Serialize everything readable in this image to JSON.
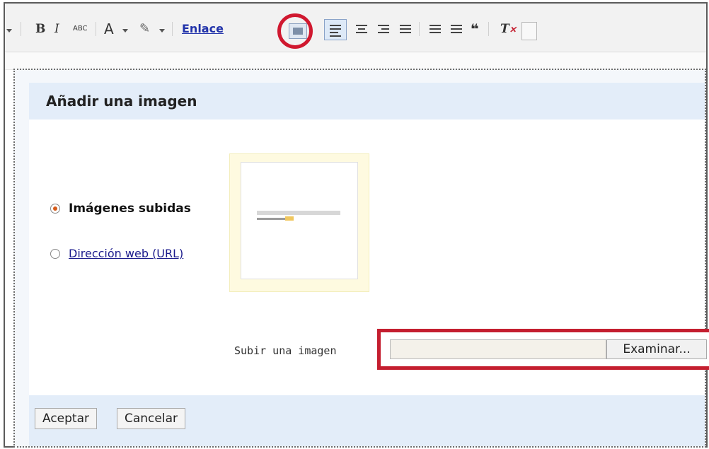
{
  "toolbar": {
    "bold_label": "B",
    "italic_label": "I",
    "spellcheck_label": "ABC",
    "font_label": "A",
    "link_label": "Enlace"
  },
  "dialog": {
    "title": "Añadir una imagen",
    "options": [
      {
        "label": "Imágenes subidas",
        "selected": true
      },
      {
        "label": "Dirección web (URL)",
        "selected": false
      }
    ],
    "upload_label": "Subir una imagen",
    "file_value": "",
    "browse_label": "Examinar...",
    "accept_label": "Aceptar",
    "cancel_label": "Cancelar"
  },
  "colors": {
    "highlight": "#c41e2f",
    "dialog_band": "#e3edf9",
    "link": "#1a1a8c"
  }
}
